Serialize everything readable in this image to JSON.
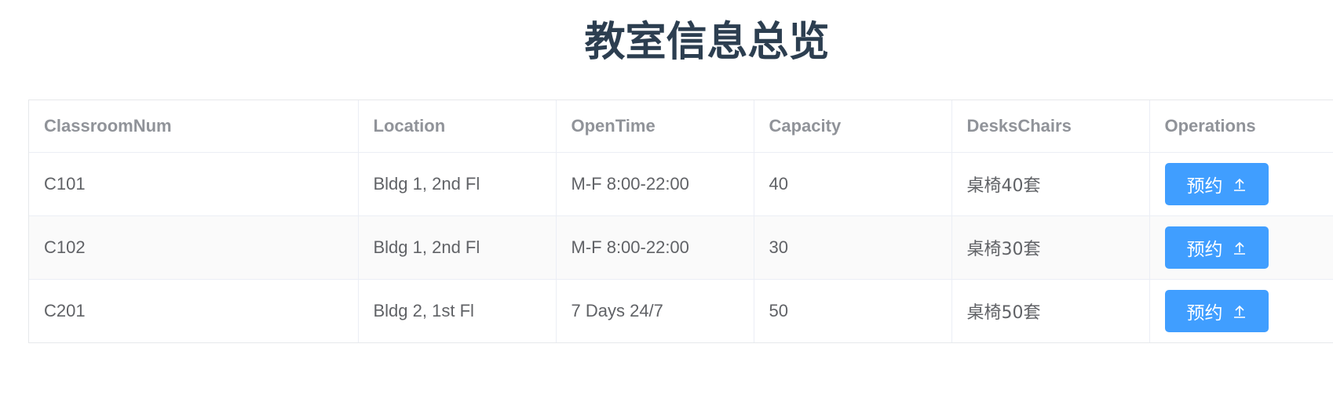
{
  "page": {
    "title": "教室信息总览"
  },
  "table": {
    "columns": [
      "ClassroomNum",
      "Location",
      "OpenTime",
      "Capacity",
      "DesksChairs",
      "Operations"
    ],
    "rows": [
      {
        "classroom": "C101",
        "location": "Bldg 1, 2nd Fl",
        "open_time": "M-F 8:00-22:00",
        "capacity": "40",
        "desks": "桌椅40套",
        "action": "预约"
      },
      {
        "classroom": "C102",
        "location": "Bldg 1, 2nd Fl",
        "open_time": "M-F 8:00-22:00",
        "capacity": "30",
        "desks": "桌椅30套",
        "action": "预约"
      },
      {
        "classroom": "C201",
        "location": "Bldg 2, 1st Fl",
        "open_time": "7 Days 24/7",
        "capacity": "50",
        "desks": "桌椅50套",
        "action": "预约"
      }
    ]
  },
  "icons": {
    "action_icon": "upload-arrow-icon"
  },
  "colors": {
    "title": "#2c3e50",
    "primary_button": "#409eff",
    "header_text": "#909399",
    "cell_text": "#606266",
    "stripe": "#fafafa",
    "border": "#ebeef5"
  }
}
